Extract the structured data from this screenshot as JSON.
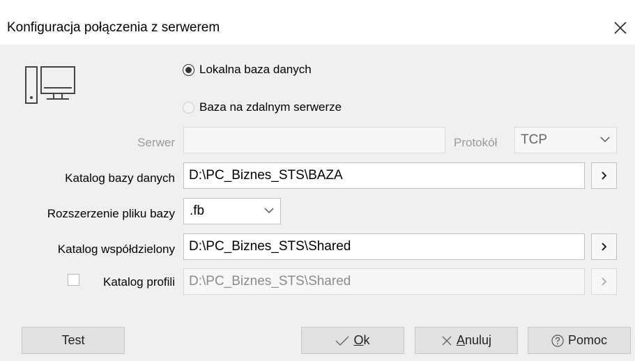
{
  "window": {
    "title": "Konfiguracja połączenia z serwerem"
  },
  "icons": {
    "close": "close-icon",
    "computer": "computer-icon",
    "browse": "chevron-right-icon",
    "dropdown": "chevron-down-icon",
    "ok": "checkmark-icon",
    "cancel": "x-icon",
    "help": "help-circle-icon"
  },
  "connection": {
    "local_label": "Lokalna baza danych",
    "remote_label": "Baza na zdalnym serwerze",
    "selected": "local"
  },
  "server": {
    "label": "Serwer",
    "value": ""
  },
  "protocol": {
    "label": "Protokół",
    "value": "TCP"
  },
  "database_dir": {
    "label": "Katalog bazy danych",
    "value": "D:\\PC_Biznes_STS\\BAZA"
  },
  "extension": {
    "label": "Rozszerzenie pliku bazy",
    "value": ".fb"
  },
  "shared_dir": {
    "label": "Katalog współdzielony",
    "value": "D:\\PC_Biznes_STS\\Shared"
  },
  "profiles_dir": {
    "label": "Katalog profili",
    "value": "D:\\PC_Biznes_STS\\Shared",
    "checked": false
  },
  "buttons": {
    "test": "Test",
    "ok_mnemonic": "O",
    "ok_rest": "k",
    "cancel_mnemonic": "A",
    "cancel_rest": "nuluj",
    "help": "Pomoc"
  }
}
